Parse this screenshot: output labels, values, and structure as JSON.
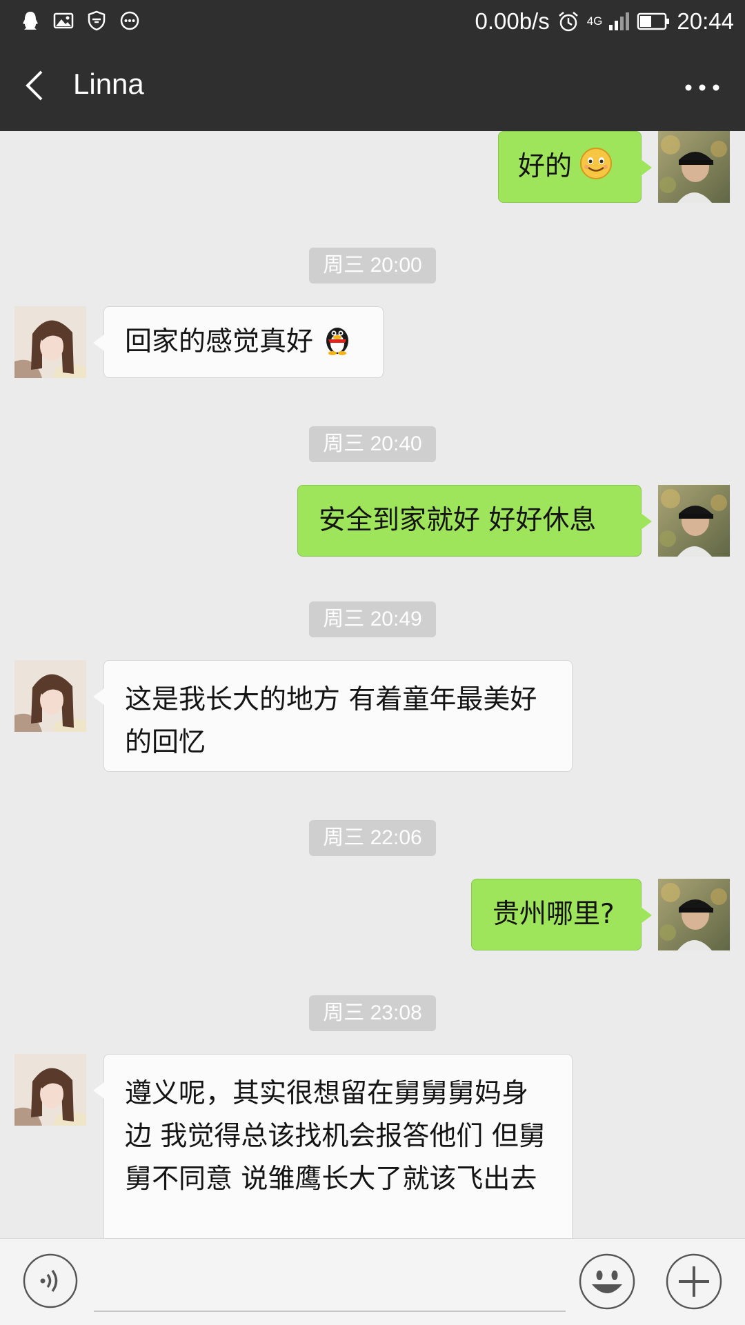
{
  "status_bar": {
    "net_speed": "0.00b/s",
    "network": "4G",
    "time": "20:44",
    "icons": [
      "qq-icon",
      "image-icon",
      "shield-icon",
      "more-circle-icon",
      "alarm-icon",
      "signal-icon",
      "battery-icon"
    ]
  },
  "header": {
    "title": "Linna",
    "back_icon": "chevron-left-icon",
    "more_icon": "more-horizontal-icon"
  },
  "messages": [
    {
      "type": "out",
      "text": "好的",
      "emoji": "smile-emoji"
    },
    {
      "type": "time",
      "text": "周三 20:00"
    },
    {
      "type": "in",
      "text": "回家的感觉真好",
      "emoji": "penguin-emoji"
    },
    {
      "type": "time",
      "text": "周三 20:40"
    },
    {
      "type": "out",
      "text": "安全到家就好 好好休息"
    },
    {
      "type": "time",
      "text": "周三 20:49"
    },
    {
      "type": "in",
      "text": "这是我长大的地方 有着童年最美好的回忆"
    },
    {
      "type": "time",
      "text": "周三 22:06"
    },
    {
      "type": "out",
      "text": "贵州哪里?"
    },
    {
      "type": "time",
      "text": "周三 23:08"
    },
    {
      "type": "in",
      "text": "遵义呢，其实很想留在舅舅舅妈身边 我觉得总该找机会报答他们 但舅舅不同意 说雏鹰长大了就该飞出去"
    }
  ],
  "input_bar": {
    "placeholder": "",
    "icons": [
      "voice-icon",
      "emoji-icon",
      "add-icon"
    ]
  },
  "colors": {
    "header_bg": "#2f2f2f",
    "chat_bg": "#ebebeb",
    "outgoing_bubble": "#9fe55b",
    "incoming_bubble": "#fafbfa",
    "timestamp_bg": "#cfcfcf"
  }
}
